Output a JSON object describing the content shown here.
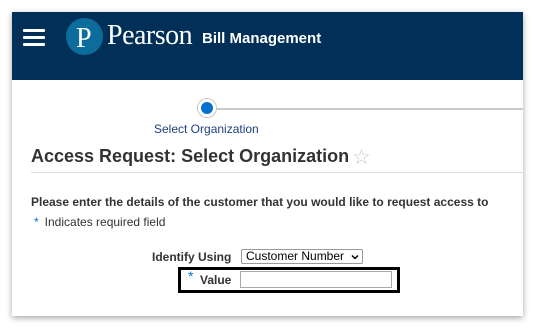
{
  "header": {
    "brand": "Pearson",
    "app_name": "Bill Management",
    "logo_letter": "P",
    "background_color": "#003057",
    "logo_color": "#0c6c9c"
  },
  "train": {
    "steps": [
      {
        "label": "Select Organization",
        "state": "current"
      }
    ],
    "accent_color": "#0572ce"
  },
  "page": {
    "title": "Access Request: Select Organization",
    "favorite_icon": "star-outline-icon"
  },
  "form": {
    "instruction": "Please enter the details of the customer that you would like to request access to",
    "required_marker": "*",
    "required_note": "Indicates required field",
    "identify_label": "Identify Using",
    "identify_selected": "Customer Number",
    "value_marker": "*",
    "value_label": "Value",
    "value_input": ""
  }
}
